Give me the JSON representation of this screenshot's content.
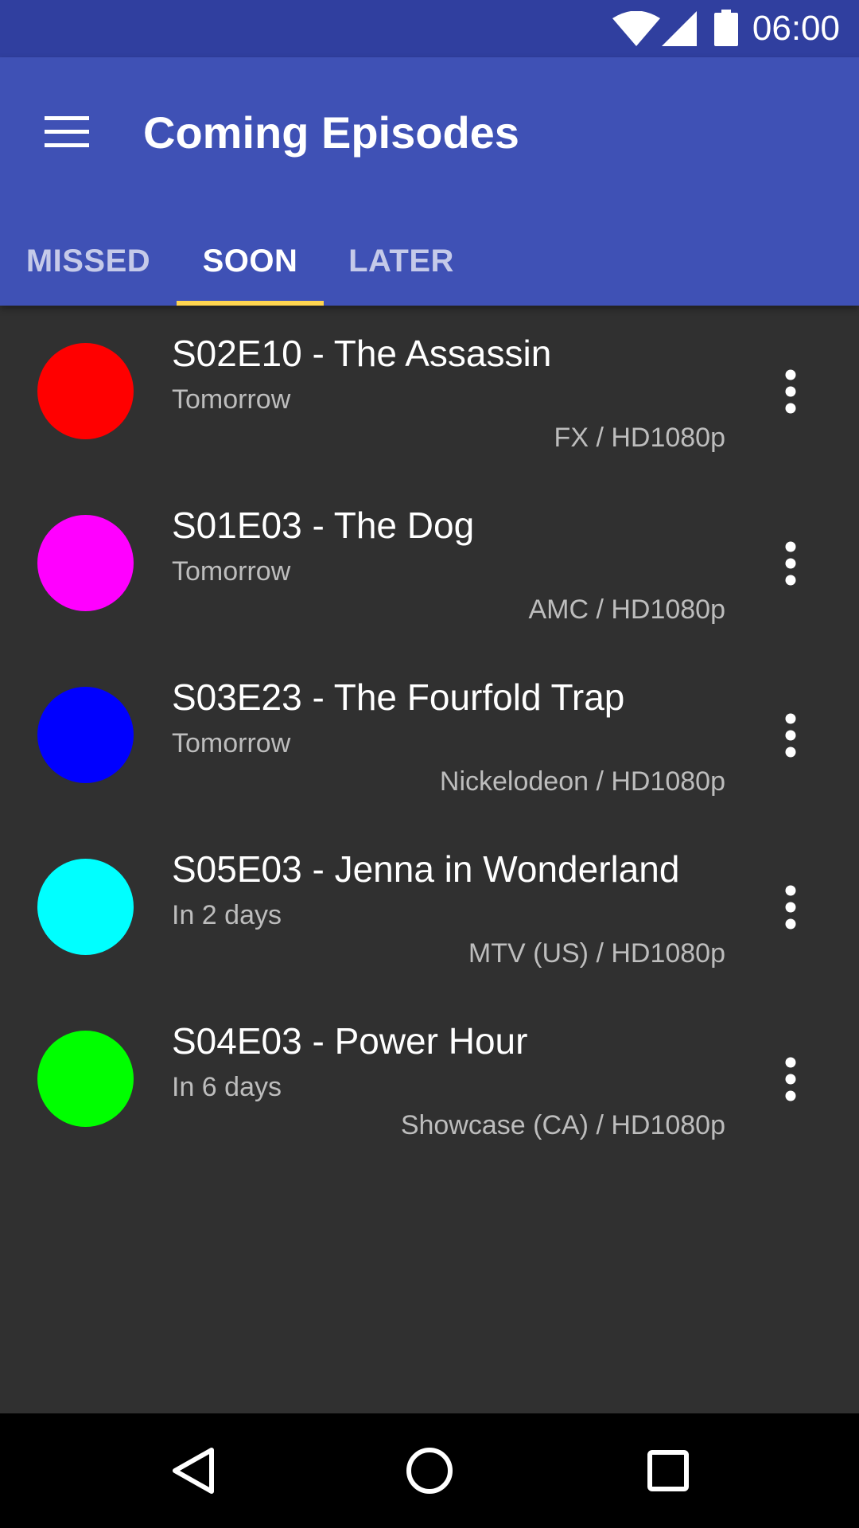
{
  "status_bar": {
    "time": "06:00",
    "icons": [
      "wifi-icon",
      "cell-signal-icon",
      "battery-icon"
    ]
  },
  "app_bar": {
    "title": "Coming Episodes",
    "menu_icon": "hamburger-menu-icon",
    "background_color": "#3F51B5"
  },
  "tabs": [
    {
      "label": "MISSED",
      "active": false
    },
    {
      "label": "SOON",
      "active": true
    },
    {
      "label": "LATER",
      "active": false
    }
  ],
  "tab_indicator_color": "#FFD54F",
  "episodes": [
    {
      "title": "S02E10 - The Assassin",
      "when": "Tomorrow",
      "network": "FX / HD1080p",
      "poster_color": "#FF0000"
    },
    {
      "title": "S01E03 - The Dog",
      "when": "Tomorrow",
      "network": "AMC / HD1080p",
      "poster_color": "#FF00FF"
    },
    {
      "title": "S03E23 - The Fourfold Trap",
      "when": "Tomorrow",
      "network": "Nickelodeon / HD1080p",
      "poster_color": "#0000FF"
    },
    {
      "title": "S05E03 - Jenna in Wonderland",
      "when": "In 2 days",
      "network": "MTV (US) / HD1080p",
      "poster_color": "#00FFFF"
    },
    {
      "title": "S04E03 - Power Hour",
      "when": "In 6 days",
      "network": "Showcase (CA) / HD1080p",
      "poster_color": "#00FF00"
    }
  ],
  "nav_bar": {
    "icons": [
      "back-icon",
      "home-icon",
      "recents-icon"
    ]
  }
}
